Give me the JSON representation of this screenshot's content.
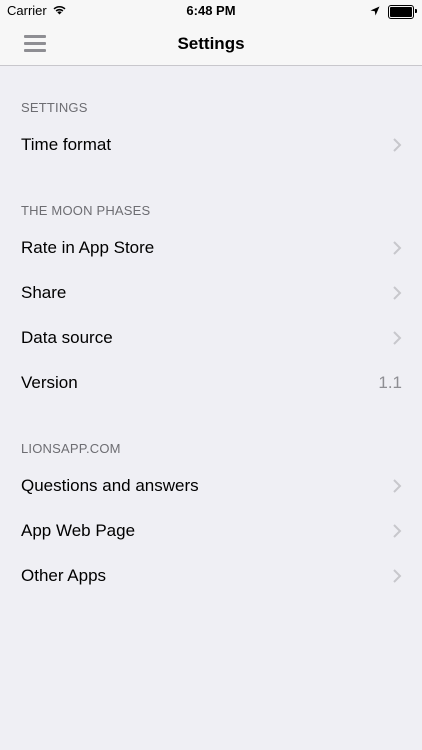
{
  "status_bar": {
    "carrier": "Carrier",
    "time": "6:48 PM"
  },
  "nav": {
    "title": "Settings"
  },
  "sections": [
    {
      "header": "SETTINGS",
      "items": [
        {
          "label": "Time format"
        }
      ]
    },
    {
      "header": "THE MOON PHASES",
      "items": [
        {
          "label": "Rate in App Store"
        },
        {
          "label": "Share"
        },
        {
          "label": "Data source"
        },
        {
          "label": "Version",
          "value": "1.1"
        }
      ]
    },
    {
      "header": "LIONSAPP.COM",
      "items": [
        {
          "label": "Questions and answers"
        },
        {
          "label": "App Web Page"
        },
        {
          "label": "Other Apps"
        }
      ]
    }
  ],
  "colors": {
    "background": "#efeff4",
    "header_text": "#6d6d72",
    "chevron": "#c7c7cc",
    "secondary_text": "#8e8e93"
  }
}
